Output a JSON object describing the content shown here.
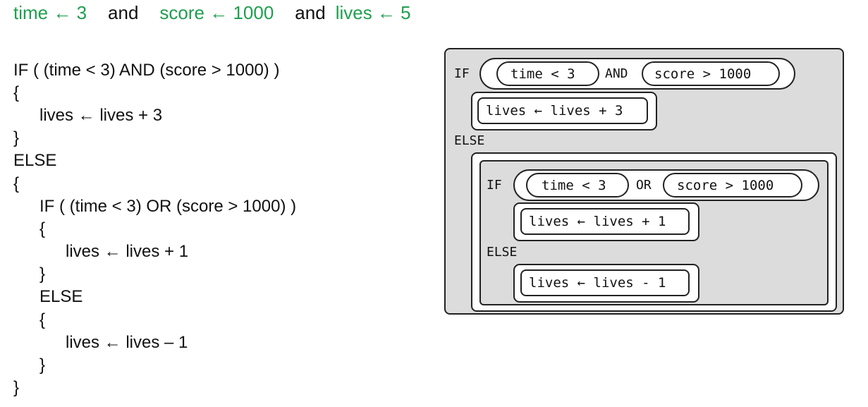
{
  "header": {
    "time_assign": "time ← 3",
    "and_1": "and",
    "score_assign": "score ← 1000",
    "and_2": "and",
    "lives_assign": "lives ← 5"
  },
  "code": {
    "outer_if": "IF  ( (time < 3) AND (score > 1000) )",
    "open_1": "{",
    "stmt_plus3": "lives ← lives + 3",
    "close_1": "}",
    "outer_else": "ELSE",
    "open_2": "{",
    "inner_if": "IF  ( (time < 3) OR (score > 1000) )",
    "open_3": "{",
    "stmt_plus1": "lives ← lives + 1",
    "close_3": "}",
    "inner_else": "ELSE",
    "open_4": "{",
    "stmt_minus1": "lives ← lives – 1",
    "close_4": "}",
    "close_2": "}"
  },
  "blocks": {
    "if_kw": "IF",
    "cond_a": "time < 3",
    "and_kw": "AND",
    "cond_b": "score > 1000",
    "stmt_plus3": "lives ← lives + 3",
    "else_kw": "ELSE",
    "inner_if_kw": "IF",
    "inner_cond_a": "time < 3",
    "or_kw": "OR",
    "inner_cond_b": "score > 1000",
    "stmt_plus1": "lives ← lives + 1",
    "inner_else_kw": "ELSE",
    "stmt_minus1": "lives ← lives - 1"
  },
  "colors": {
    "highlight": "#1f9f4f",
    "block_fill": "#dcdcdc",
    "outline": "#222222"
  }
}
